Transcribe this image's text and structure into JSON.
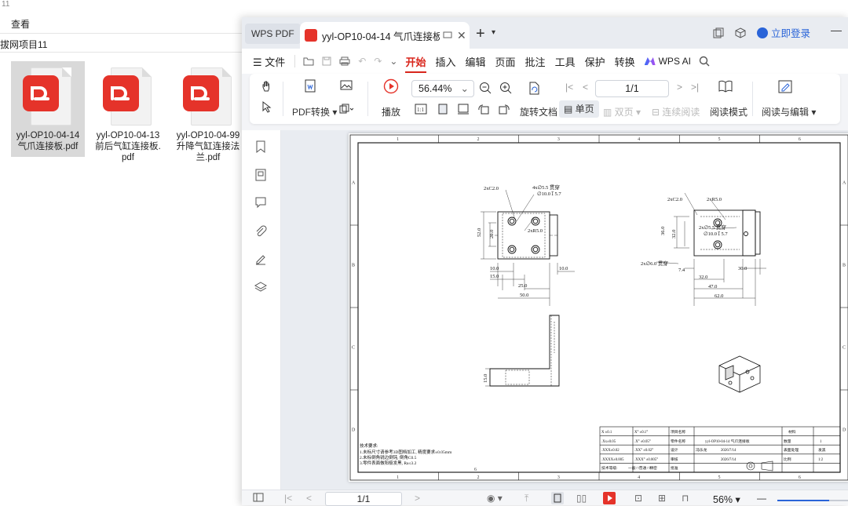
{
  "explorer": {
    "title": "11",
    "menu_view": "查看",
    "path": "拔网项目11",
    "files": [
      {
        "name": "yyl-OP10-04-14 气爪连接板.pdf",
        "selected": true
      },
      {
        "name": "yyl-OP10-04-13 前后气缸连接板.pdf",
        "selected": false
      },
      {
        "name": "yyl-OP10-04-99 升降气缸连接法兰.pdf",
        "selected": false
      }
    ]
  },
  "wps": {
    "brand_tab": "WPS PDF",
    "doc_tab": "yyl-OP10-04-14 气爪连接板.p",
    "login": "立即登录",
    "menu": {
      "file": "文件",
      "items": [
        "开始",
        "插入",
        "编辑",
        "页面",
        "批注",
        "工具",
        "保护",
        "转换"
      ],
      "active": "开始",
      "ai": "WPS AI"
    },
    "ribbon": {
      "pdf_convert": "PDF转换",
      "play": "播放",
      "zoom": "56.44%",
      "rotate": "旋转文档",
      "page": "1/1",
      "single": "单页",
      "double": "双页",
      "continuous": "连续阅读",
      "read_mode": "阅读模式",
      "read_edit": "阅读与编辑"
    },
    "status": {
      "page": "1/1",
      "zoom": "56%"
    }
  },
  "drawing": {
    "cols": [
      "1",
      "2",
      "3",
      "4",
      "5",
      "6"
    ],
    "rows": [
      "A",
      "B",
      "C",
      "D"
    ],
    "front_dims": {
      "chamfer": "2xC2.0",
      "holes": "4x∅5.5 贯穿",
      "cbore": "∅10.0↧5.7",
      "radius": "2xR5.0",
      "h1": "52.0",
      "h2": "20.0",
      "w1": "10.0",
      "w2": "15.0",
      "w3": "25.0",
      "w4": "50.0",
      "w5": "10.0"
    },
    "right_dims": {
      "chamfer": "2xC2.0",
      "radius": "2xR5.0",
      "holes": "2x∅5.5 贯穿",
      "cbore": "∅10.0↧5.7",
      "pin": "2x∅6.0 贯穿",
      "h1": "36.0",
      "h2": "32.0",
      "w1": "7.4",
      "w2": "32.0",
      "w3": "47.0",
      "w4": "62.0",
      "w5": "30.0"
    },
    "bottom_dims": {
      "h": "15.0"
    },
    "notes_title": "技术要求:",
    "notes": [
      "1.未标尺寸请参考3D图档加工, 精度要求±0.05mm",
      "2.未标倒角锐边倒钝, 倒角C0.5",
      "3.零件表面做阳极发黑, Ra≤3.2"
    ],
    "title_block": {
      "part": "yyl-OP10-04-14 气爪连接板",
      "material": "材料",
      "qty": "数量",
      "qty_val": "1",
      "surface": "表面处理",
      "surface_val": "发黑",
      "scale": "比例",
      "scale_val": "1:2",
      "designer": "冯乐龙",
      "date1": "2026/7/14",
      "date2": "2026/7/14",
      "labels": [
        "项目名称",
        "零件名称",
        "设计",
        "审核",
        "批准"
      ],
      "tolerances": [
        "X ±0.1",
        ".Xx±0.05",
        ".XXX±0.02",
        ".XXXX±0.005",
        "技术等级:"
      ],
      "angles": [
        "X° ±0.1°",
        ".X° ±0.05°",
        ".XX° ±0.02°",
        ".XXX° ±0.005°",
        "一般 □普通 □精密"
      ],
      "page_num": "6"
    }
  }
}
